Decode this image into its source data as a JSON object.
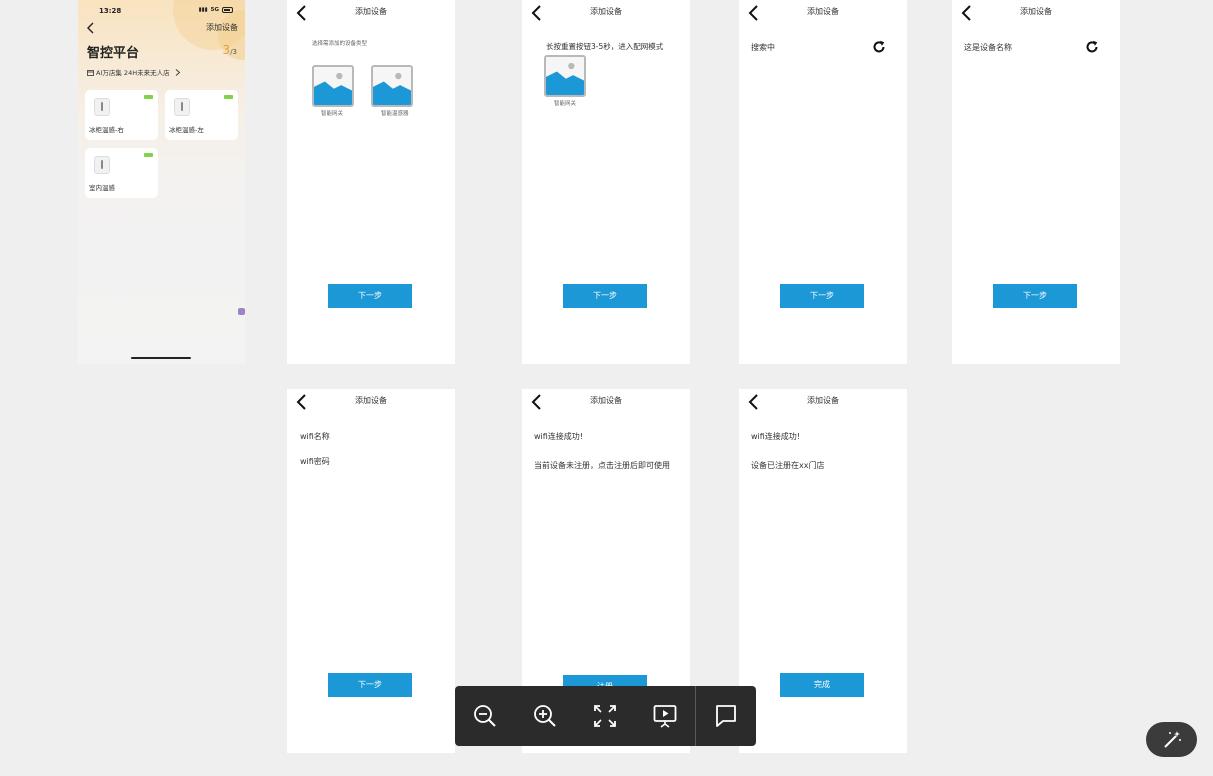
{
  "home": {
    "status_time": "13:28",
    "status_network": "5G",
    "add_device": "添加设备",
    "platform_title": "智控平台",
    "count_current": "3",
    "count_total": "/3",
    "store_name": "AI万店集 24H未来无人店",
    "devices": [
      {
        "label": "冰柜温感-右"
      },
      {
        "label": "冰柜温感-左"
      },
      {
        "label": "室内温感"
      }
    ]
  },
  "screens": {
    "select_type": {
      "title": "添加设备",
      "hint": "选择需添加的设备类型",
      "options": [
        "智能网关",
        "智能温感器"
      ],
      "next": "下一步"
    },
    "reset": {
      "title": "添加设备",
      "hint": "长按重置按钮3-5秒，进入配网模式",
      "option": "智能网关",
      "next": "下一步"
    },
    "searching": {
      "title": "添加设备",
      "status": "搜索中",
      "next": "下一步"
    },
    "device_name": {
      "title": "添加设备",
      "status": "这是设备名称",
      "next": "下一步"
    },
    "wifi": {
      "title": "添加设备",
      "wifi_name": "wifi名称",
      "wifi_password": "wifi密码",
      "next": "下一步"
    },
    "unregistered": {
      "title": "添加设备",
      "line1": "wifi连接成功!",
      "line2": "当前设备未注册，点击注册后即可使用",
      "register": "注册"
    },
    "registered": {
      "title": "添加设备",
      "line1": "wifi连接成功!",
      "line2": "设备已注册在xx门店",
      "done": "完成"
    }
  },
  "toolbar": {
    "icons": [
      "zoom-out-icon",
      "zoom-in-icon",
      "fit-screen-icon",
      "present-icon",
      "comment-icon"
    ]
  },
  "colors": {
    "primary_button": "#1d98d6",
    "background": "#efefef",
    "toolbar": "#2b2b2b"
  }
}
